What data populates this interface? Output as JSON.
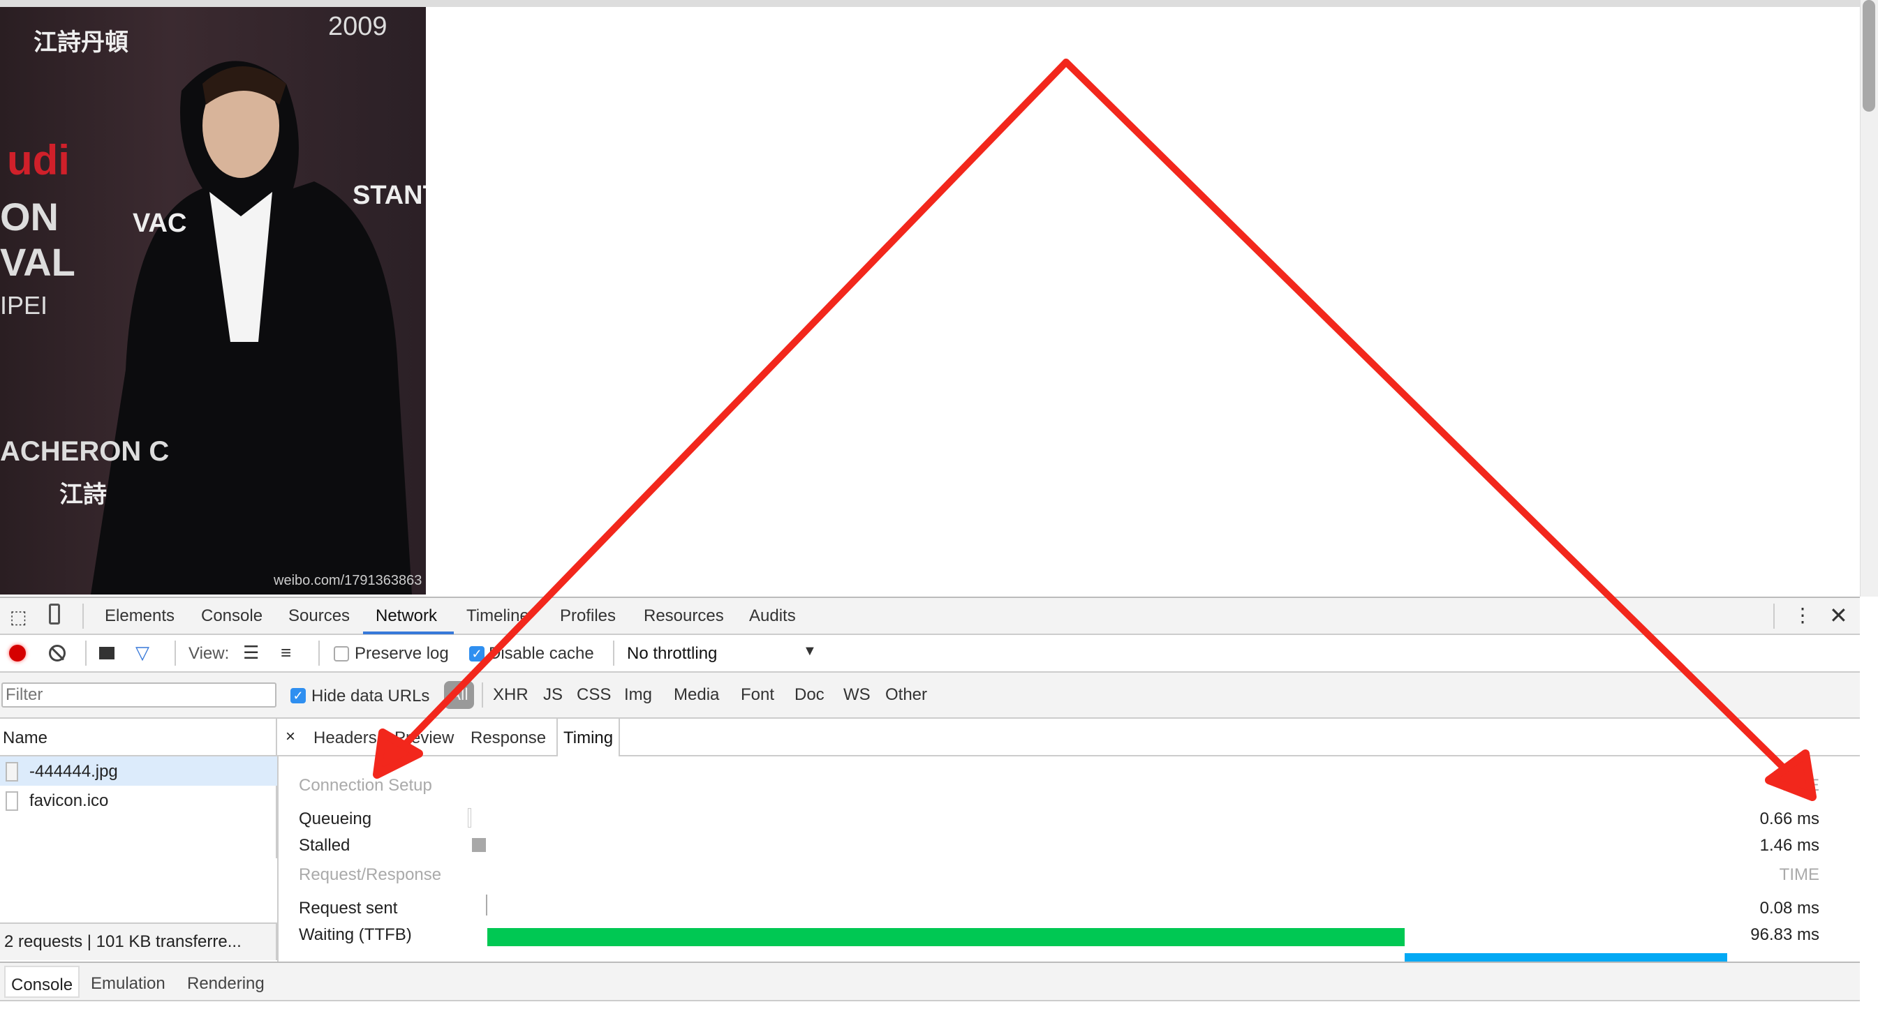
{
  "page": {
    "photo_watermark": "weibo.com/1791363863",
    "photo_signage": [
      "2009",
      "udi",
      "ON",
      "VAL",
      "IPEI",
      "STANTIN",
      "VAC",
      "ACHERON C",
      "江詩丹頓",
      "江詩"
    ]
  },
  "devtools": {
    "tabs": [
      "Elements",
      "Console",
      "Sources",
      "Network",
      "Timeline",
      "Profiles",
      "Resources",
      "Audits"
    ],
    "active_tab": "Network",
    "toolbar": {
      "view_label": "View:",
      "preserve_log": "Preserve log",
      "preserve_log_checked": false,
      "disable_cache": "Disable cache",
      "disable_cache_checked": true,
      "throttling": "No throttling"
    },
    "filter": {
      "placeholder": "Filter",
      "hide_data_urls": "Hide data URLs",
      "hide_data_urls_checked": true,
      "types": [
        "All",
        "XHR",
        "JS",
        "CSS",
        "Img",
        "Media",
        "Font",
        "Doc",
        "WS",
        "Other"
      ]
    },
    "requests": {
      "header": "Name",
      "items": [
        "-444444.jpg",
        "favicon.ico"
      ],
      "selected": 0,
      "status": "2 requests | 101 KB transferre..."
    },
    "detail": {
      "close": "×",
      "tabs": [
        "Headers",
        "Preview",
        "Response",
        "Timing"
      ],
      "active_tab": "Timing",
      "sections": [
        {
          "title": "Connection Setup",
          "time_header": "TIME",
          "rows": [
            {
              "label": "Queueing",
              "time": "0.66 ms"
            },
            {
              "label": "Stalled",
              "time": "1.46 ms"
            }
          ]
        },
        {
          "title": "Request/Response",
          "time_header": "TIME",
          "rows": [
            {
              "label": "Request sent",
              "time": "0.08 ms"
            },
            {
              "label": "Waiting (TTFB)",
              "time": "96.83 ms"
            }
          ]
        }
      ]
    },
    "drawer_tabs": [
      "Console",
      "Emulation",
      "Rendering"
    ],
    "colors": {
      "accent": "#3879d9",
      "waiting": "#00c853",
      "download": "#03a9f4",
      "record": "#d50000",
      "annotation": "#f2271c"
    }
  }
}
